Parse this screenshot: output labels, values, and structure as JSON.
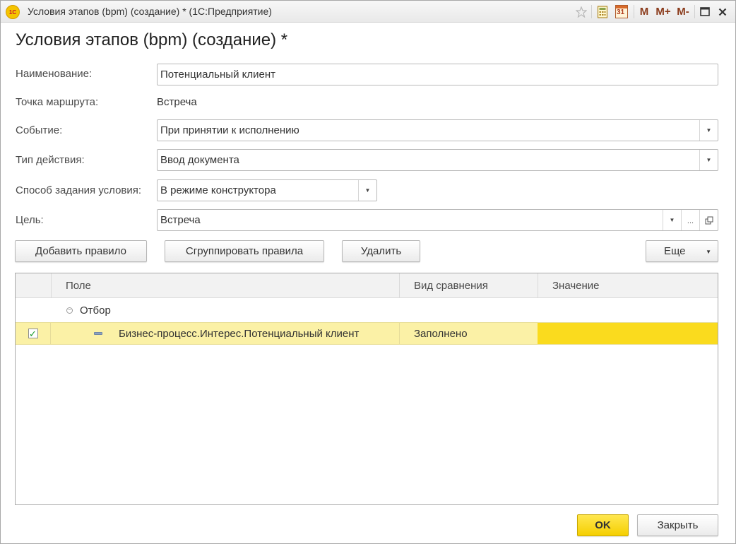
{
  "window": {
    "title": "Условия этапов (bpm) (создание) * (1С:Предприятие)",
    "logo_text": "1C",
    "toolbar": {
      "m_label": "M",
      "mplus_label": "M+",
      "mminus_label": "M-",
      "calendar_day": "31"
    }
  },
  "form": {
    "title": "Условия этапов (bpm) (создание) *",
    "fields": {
      "name_label": "Наименование:",
      "name_value": "Потенциальный клиент",
      "route_point_label": "Точка маршрута:",
      "route_point_value": "Встреча",
      "event_label": "Событие:",
      "event_value": "При принятии к исполнению",
      "action_type_label": "Тип действия:",
      "action_type_value": "Ввод документа",
      "condition_method_label": "Способ задания условия:",
      "condition_method_value": "В режиме конструктора",
      "goal_label": "Цель:",
      "goal_value": "Встреча",
      "ellipsis": "..."
    },
    "buttons": {
      "add_rule": "Добавить правило",
      "group_rules": "Сгруппировать правила",
      "delete": "Удалить",
      "more": "Еще",
      "ok": "OK",
      "close": "Закрыть"
    }
  },
  "table": {
    "columns": [
      "Поле",
      "Вид сравнения",
      "Значение"
    ],
    "group": {
      "label": "Отбор",
      "expanded": true
    },
    "rows": [
      {
        "checked": true,
        "field": "Бизнес-процесс.Интерес.Потенциальный клиент",
        "comparison": "Заполнено",
        "value": ""
      }
    ]
  },
  "colors": {
    "accent_yellow": "#f5cf00",
    "selected_row": "#fbf1a6",
    "selected_cell": "#fadb1e",
    "check_green": "#1a9a2a"
  }
}
